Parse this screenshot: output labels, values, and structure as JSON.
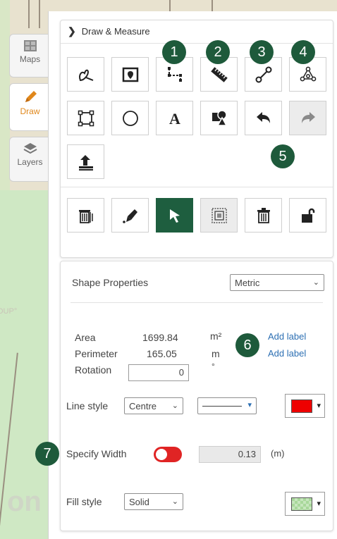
{
  "tabs": [
    {
      "label": "Maps",
      "icon": "maps-icon"
    },
    {
      "label": "Draw",
      "icon": "pencil-icon"
    },
    {
      "label": "Layers",
      "icon": "layers-icon"
    }
  ],
  "map": {
    "label_left": "OUP°"
  },
  "panel": {
    "title": "Draw & Measure",
    "badges": [
      "1",
      "2",
      "3",
      "4",
      "5",
      "6",
      "7"
    ]
  },
  "shape_properties": {
    "title": "Shape Properties",
    "unit_system": "Metric",
    "area_label": "Area",
    "area_value": "1699.84",
    "area_unit": "m²",
    "perimeter_label": "Perimeter",
    "perimeter_value": "165.05",
    "perimeter_unit": "m",
    "rotation_label": "Rotation",
    "rotation_value": "0",
    "rotation_unit": "°",
    "add_label_1": "Add label",
    "add_label_2": "Add label",
    "line_style_label": "Line style",
    "line_position": "Centre",
    "line_color": "#ee0000",
    "specify_width_label": "Specify Width",
    "toggle_color": "#e02424",
    "width_value": "0.13",
    "width_unit": "(m)",
    "fill_style_label": "Fill style",
    "fill_style": "Solid",
    "fill_color": "#a8d89a"
  },
  "colors": {
    "accent_green": "#1e5e3f",
    "draw_orange": "#e0871b",
    "link_blue": "#2c6fb3"
  }
}
